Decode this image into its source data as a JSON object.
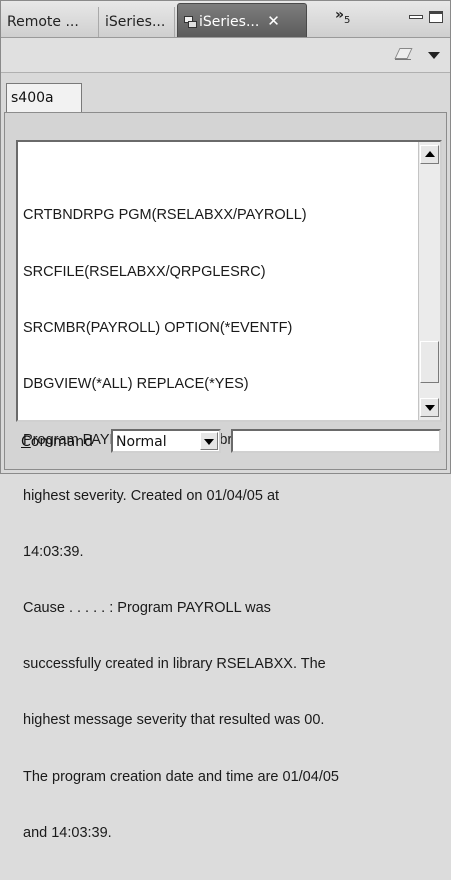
{
  "tabs": [
    {
      "label": "Remote ..."
    },
    {
      "label": "iSeries..."
    },
    {
      "label": "iSeries...",
      "close": "✕",
      "icon": "iseries-table-icon"
    }
  ],
  "tab_overflow": {
    "symbol": "»",
    "count": "5"
  },
  "inner_tab": {
    "label": "s400a"
  },
  "output": {
    "lines": [
      "CRTBNDRPG PGM(RSELABXX/PAYROLL)",
      "SRCFILE(RSELABXX/QRPGLESRC)",
      "SRCMBR(PAYROLL) OPTION(*EVENTF)",
      "DBGVIEW(*ALL) REPLACE(*YES)",
      "Program PAYROLL placed in library RSELABXX. 00",
      "highest severity. Created on 01/04/05 at",
      "14:03:39.",
      "Cause . . . . . :   Program PAYROLL was",
      "successfully created in library RSELABXX. The",
      "highest message severity that resulted was 00.",
      "The program creation date and time are 01/04/05",
      "and 14:03:39."
    ]
  },
  "scrollbar": {
    "position": 0.92,
    "visible_fraction": 0.18
  },
  "command": {
    "label_accel": "C",
    "label_rest": "ommand",
    "mode_value": "Normal",
    "input_value": ""
  },
  "icons": {
    "toolbar_clear": "eraser-icon",
    "view_menu": "view-menu-icon",
    "minimize": "minimize-icon",
    "maximize": "maximize-icon"
  }
}
